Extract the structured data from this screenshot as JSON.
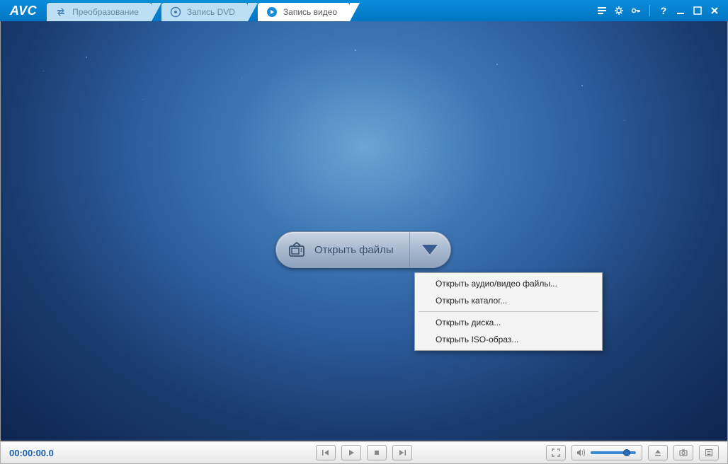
{
  "app": {
    "logo": "AVC"
  },
  "tabs": [
    {
      "label": "Преобразование",
      "active": false,
      "icon": "convert"
    },
    {
      "label": "Запись DVD",
      "active": false,
      "icon": "dvd"
    },
    {
      "label": "Запись видео",
      "active": true,
      "icon": "play"
    }
  ],
  "open_button": {
    "label": "Открыть файлы"
  },
  "dropdown": {
    "items": [
      "Открыть аудио/видео файлы...",
      "Открыть каталог..."
    ],
    "items2": [
      "Открыть диска...",
      "Открыть ISO-образ..."
    ]
  },
  "player": {
    "timecode": "00:00:00.0"
  }
}
